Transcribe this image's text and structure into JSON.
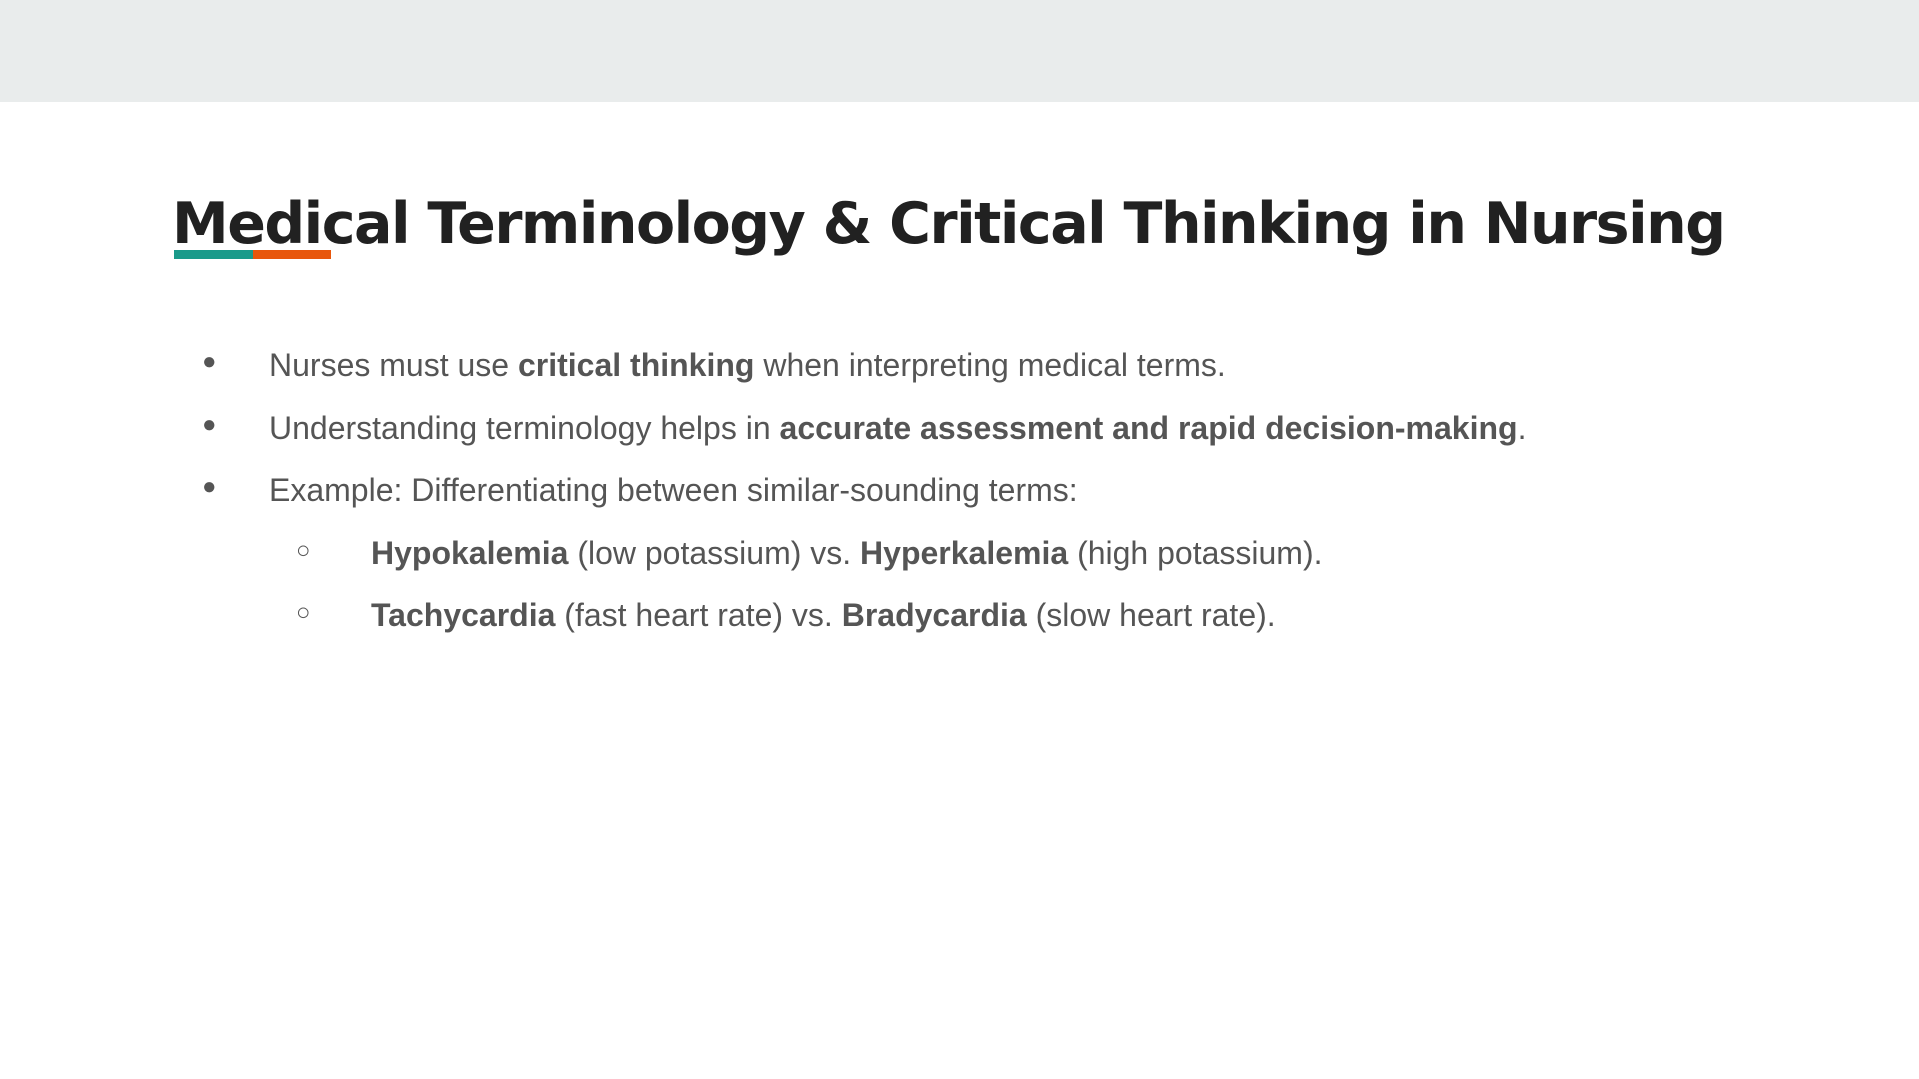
{
  "colors": {
    "top_bar": "#e9ecec",
    "background": "#ffffff",
    "accent_teal": "#1a9a8a",
    "accent_orange": "#e8570c",
    "title_text": "#212121",
    "body_text": "#555555"
  },
  "slide": {
    "title": "Medical Terminology & Critical Thinking in Nursing",
    "bullets": [
      {
        "marker": "●",
        "parts": [
          "Nurses must use ",
          "critical thinking",
          " when interpreting medical terms."
        ]
      },
      {
        "marker": "●",
        "parts": [
          "Understanding terminology helps in ",
          "accurate assessment and rapid decision-making",
          "."
        ]
      },
      {
        "marker": "●",
        "parts": [
          "Example: Differentiating between similar-sounding terms:"
        ]
      },
      {
        "marker": "○",
        "parts": [
          "Hypokalemia",
          " (low potassium) vs. ",
          "Hyperkalemia",
          " (high potassium)."
        ]
      },
      {
        "marker": "○",
        "parts": [
          "Tachycardia",
          " (fast heart rate) vs. ",
          "Bradycardia",
          " (slow heart rate)."
        ]
      }
    ]
  }
}
